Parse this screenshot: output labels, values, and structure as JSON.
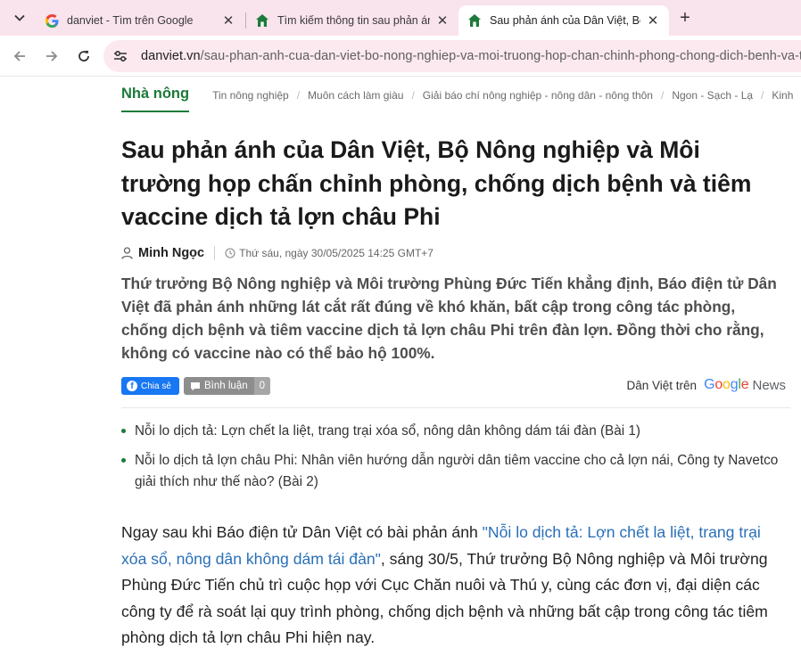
{
  "browser": {
    "tabs": [
      {
        "title": "danviet - Tìm trên Google",
        "favicon": "google-g-icon",
        "active": false
      },
      {
        "title": "Tìm kiếm thông tin sau phản ánh",
        "favicon": "danviet-house-icon",
        "active": false
      },
      {
        "title": "Sau phản ánh của Dân Việt, Bộ",
        "favicon": "danviet-house-icon",
        "active": true
      }
    ],
    "url_host": "danviet.vn",
    "url_path": "/sau-phan-anh-cua-dan-viet-bo-nong-nghiep-va-moi-truong-hop-chan-chinh-phong-chong-dich-benh-va-ti",
    "colors": {
      "tabstrip": "#f9e3ec",
      "omnibox": "#fce9f0"
    }
  },
  "page": {
    "category": "Nhà nông",
    "subcategories": [
      "Tin nông nghiệp",
      "Muôn cách làm giàu",
      "Giải báo chí nông nghiệp - nông dân - nông thôn",
      "Ngon - Sạch - Lạ",
      "Kinh"
    ],
    "headline": "Sau phản ánh của Dân Việt, Bộ Nông nghiệp và Môi trường họp chấn chỉnh phòng, chống dịch bệnh và tiêm vaccine dịch tả lợn châu Phi",
    "author": "Minh Ngọc",
    "date": "Thứ sáu, ngày 30/05/2025 14:25 GMT+7",
    "sapo": "Thứ trưởng Bộ Nông nghiệp và Môi trường Phùng Đức Tiến khẳng định, Báo điện tử Dân Việt đã phản ánh những lát cắt rất đúng về khó khăn, bất cập trong công tác phòng, chống dịch bệnh và tiêm vaccine dịch tả lợn châu Phi trên đàn lợn. Đồng thời cho rằng, không có vaccine nào có thể bảo hộ 100%.",
    "share": {
      "facebook_label": "Chia sẻ",
      "comment_label": "Bình luận",
      "comment_count": "0",
      "gnews_prefix": "Dân Việt trên",
      "gnews_google": "Google",
      "gnews_news": "News"
    },
    "related": [
      "Nỗi lo dịch tả: Lợn chết la liệt, trang trại xóa sổ, nông dân không dám tái đàn (Bài 1)",
      "Nỗi lo dịch tả lợn châu Phi: Nhân viên hướng dẫn người dân tiêm vaccine cho cả lợn nái, Công ty Navetco giải thích như thế nào? (Bài 2)"
    ],
    "body": {
      "before_link": "Ngay sau khi Báo điện tử Dân Việt có bài phản ánh ",
      "link_text": "\"Nỗi lo dịch tả: Lợn chết la liệt, trang trại xóa sổ, nông dân không dám tái đàn\"",
      "after_link": ", sáng 30/5, Thứ trưởng Bộ Nông nghiệp và Môi trường Phùng Đức Tiến chủ trì cuộc họp với Cục Chăn nuôi và Thú y, cùng các đơn vị, đại diện các công ty để rà soát lại quy trình phòng, chống dịch bệnh và những bất cập trong công tác tiêm phòng dịch tả lợn châu Phi hiện nay."
    },
    "colors": {
      "accent_green": "#1d7a3a",
      "link_blue": "#2a6fb8"
    }
  }
}
